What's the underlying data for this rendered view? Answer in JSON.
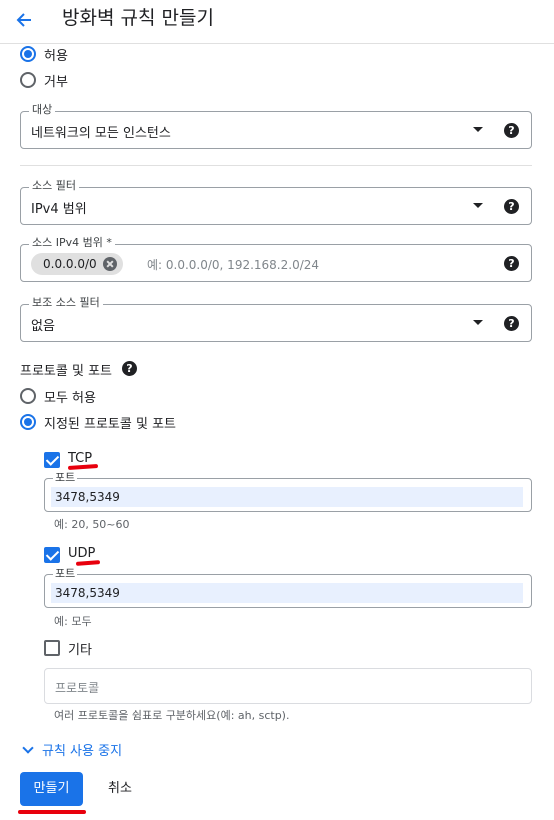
{
  "header": {
    "title": "방화벽 규칙 만들기"
  },
  "action": {
    "allow_label": "허용",
    "deny_label": "거부",
    "selected": "allow"
  },
  "target": {
    "legend": "대상",
    "value": "네트워크의 모든 인스턴스"
  },
  "source_filter": {
    "legend": "소스 필터",
    "value": "IPv4 범위"
  },
  "source_ipv4": {
    "legend": "소스 IPv4 범위 *",
    "chip": "0.0.0.0/0",
    "placeholder": "예: 0.0.0.0/0, 192.168.2.0/24"
  },
  "secondary_filter": {
    "legend": "보조 소스 필터",
    "value": "없음"
  },
  "protocols": {
    "heading": "프로토콜 및 포트",
    "allow_all_label": "모두 허용",
    "specified_label": "지정된 프로토콜 및 포트",
    "selected": "specified",
    "tcp": {
      "label": "TCP",
      "checked": true,
      "port_legend": "포트",
      "ports": "3478,5349",
      "hint": "예: 20, 50~60"
    },
    "udp": {
      "label": "UDP",
      "checked": true,
      "port_legend": "포트",
      "ports": "3478,5349",
      "hint": "예: 모두"
    },
    "other": {
      "label": "기타",
      "checked": false,
      "placeholder": "프로토콜",
      "hint": "여러 프로토콜을 쉼표로 구분하세요(예: ah, sctp)."
    }
  },
  "disable_rule": {
    "label": "규칙 사용 중지"
  },
  "buttons": {
    "create": "만들기",
    "cancel": "취소"
  },
  "icons": {
    "back": "arrow-left-icon",
    "help": "help-icon",
    "dropdown": "caret-down-icon",
    "clear": "clear-icon",
    "expand": "chevron-down-icon"
  },
  "colors": {
    "accent": "#1a73e8",
    "annotation": "#e8000d"
  }
}
